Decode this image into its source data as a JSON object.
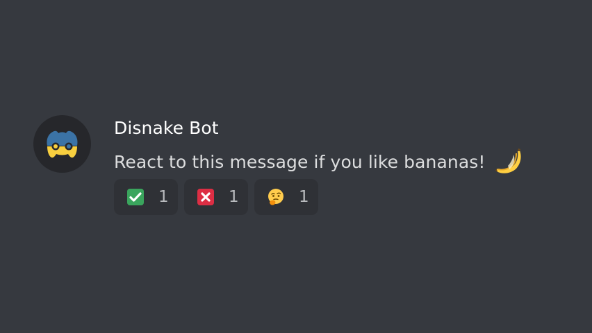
{
  "message": {
    "author": "Disnake Bot",
    "text": "React to this message if you like bananas!",
    "inline_emoji": "banana-emoji"
  },
  "reactions": [
    {
      "emoji": "check-mark-button-emoji",
      "count": "1"
    },
    {
      "emoji": "cross-mark-button-emoji",
      "count": "1"
    },
    {
      "emoji": "thinking-face-emoji",
      "count": "1"
    }
  ],
  "colors": {
    "background": "#36393f",
    "reaction_bg": "#2f3136",
    "author": "#ffffff",
    "text": "#dcddde",
    "count": "#b9bbbe",
    "avatar_bg": "#26272b",
    "python_blue": "#3b73a6",
    "python_yellow": "#f8cf3f",
    "check_green": "#3aa55d",
    "cross_red": "#dd2e44",
    "banana": "#ffcf41",
    "thinking": "#ffcc4d"
  }
}
